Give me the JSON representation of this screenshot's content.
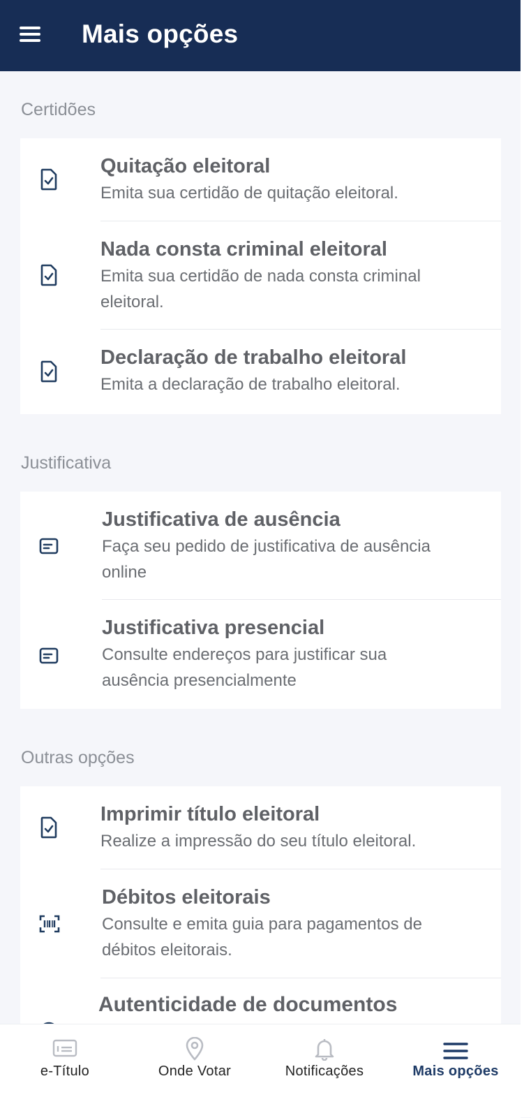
{
  "header": {
    "title": "Mais opções",
    "menu_icon": "hamburger-menu-icon"
  },
  "sections": [
    {
      "label": "Certidões",
      "items": [
        {
          "title": "Quitação eleitoral",
          "desc": "Emita sua certidão de quitação eleitoral.",
          "icon": "document-check-icon"
        },
        {
          "title": "Nada consta criminal eleitoral",
          "desc": "Emita sua certidão de nada consta criminal eleitoral.",
          "icon": "document-check-icon"
        },
        {
          "title": "Declaração de trabalho eleitoral",
          "desc": "Emita a declaração de trabalho eleitoral.",
          "icon": "document-check-icon"
        }
      ]
    },
    {
      "label": "Justificativa",
      "items": [
        {
          "title": "Justificativa de ausência",
          "desc": "Faça seu pedido de justificativa de ausência online",
          "icon": "message-card-icon"
        },
        {
          "title": "Justificativa presencial",
          "desc": "Consulte endereços para justificar sua ausência presencialmente",
          "icon": "message-card-icon"
        }
      ]
    },
    {
      "label": "Outras opções",
      "items": [
        {
          "title": "Imprimir título eleitoral",
          "desc": "Realize a impressão do seu título eleitoral.",
          "icon": "document-check-icon"
        },
        {
          "title": "Débitos eleitorais",
          "desc": "Consulte e emita guia para pagamentos de débitos eleitorais.",
          "icon": "barcode-scan-icon"
        },
        {
          "title": "Autenticidade de documentos",
          "desc": "",
          "icon": "verify-icon"
        }
      ]
    }
  ],
  "bottom_nav": [
    {
      "label": "e-Título",
      "icon": "id-card-icon",
      "active": false
    },
    {
      "label": "Onde Votar",
      "icon": "location-pin-icon",
      "active": false
    },
    {
      "label": "Notificações",
      "icon": "bell-icon",
      "active": false
    },
    {
      "label": "Mais opções",
      "icon": "menu-icon",
      "active": true
    }
  ],
  "colors": {
    "header_bg": "#172d55",
    "accent": "#1d3a66",
    "icon": "#1f3b5f",
    "background": "#f5f6fa"
  }
}
